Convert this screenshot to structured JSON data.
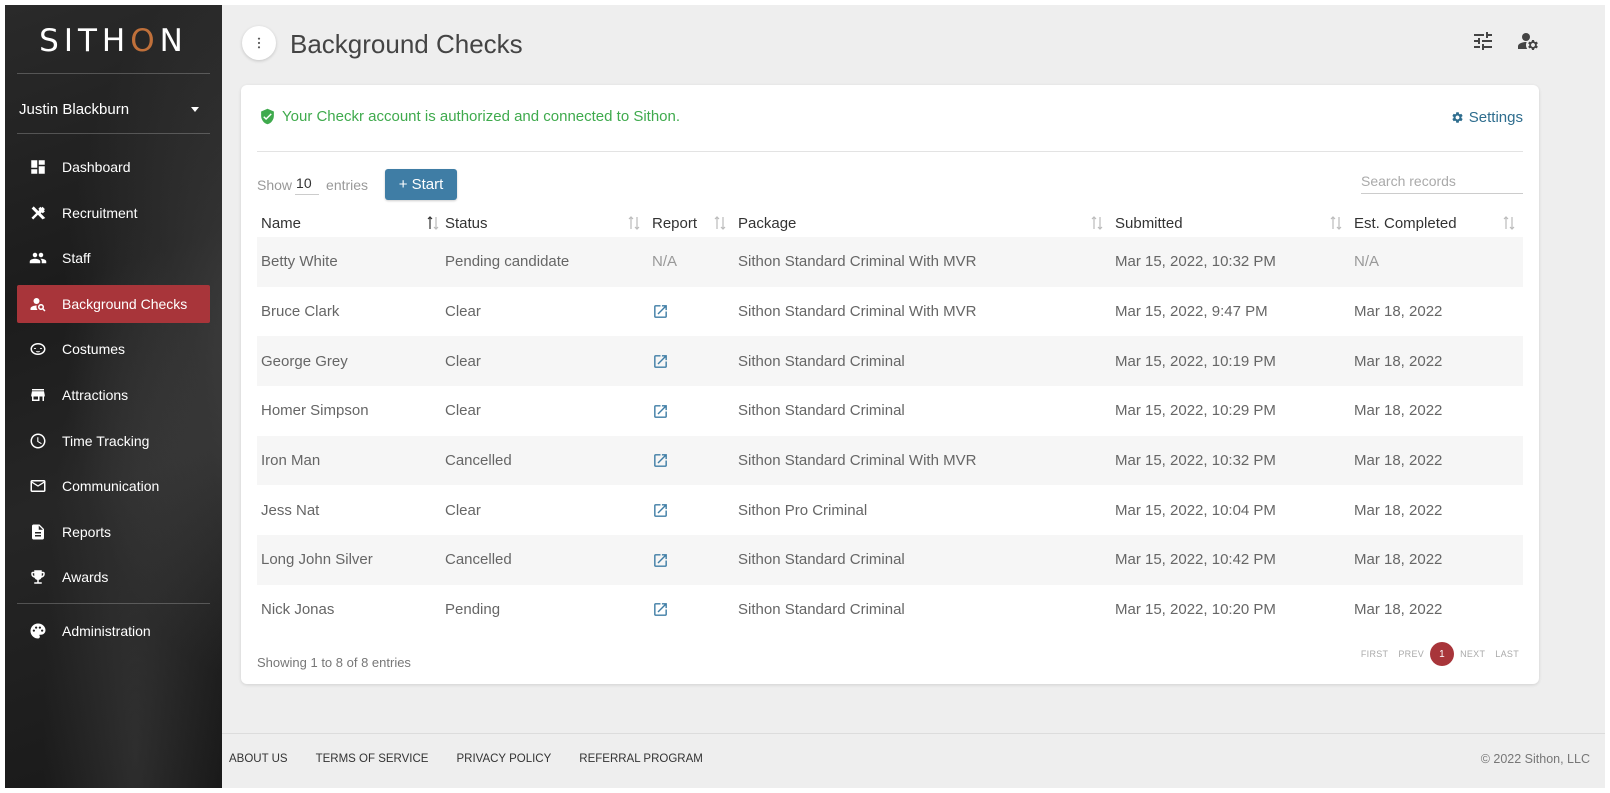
{
  "app": {
    "logo": {
      "pre": "SITH",
      "o": "O",
      "post": "N"
    },
    "user_name": "Justin Blackburn"
  },
  "sidebar": {
    "items": [
      {
        "label": "Dashboard",
        "icon": "dashboard-icon"
      },
      {
        "label": "Recruitment",
        "icon": "tools-icon"
      },
      {
        "label": "Staff",
        "icon": "people-icon"
      },
      {
        "label": "Background Checks",
        "icon": "person-search-icon",
        "active": true
      },
      {
        "label": "Costumes",
        "icon": "mask-icon"
      },
      {
        "label": "Attractions",
        "icon": "storefront-icon"
      },
      {
        "label": "Time Tracking",
        "icon": "clock-icon"
      },
      {
        "label": "Communication",
        "icon": "mail-icon"
      },
      {
        "label": "Reports",
        "icon": "document-icon"
      },
      {
        "label": "Awards",
        "icon": "trophy-icon"
      }
    ],
    "admin": {
      "label": "Administration",
      "icon": "palette-icon"
    }
  },
  "header": {
    "title": "Background Checks"
  },
  "card": {
    "auth_message": "Your Checkr account is authorized and connected to Sithon.",
    "settings_label": "Settings",
    "show_label": "Show",
    "entries_count": "10",
    "entries_label": "entries",
    "start_label": "+ Start",
    "search_placeholder": "Search records"
  },
  "table": {
    "columns": [
      "Name",
      "Status",
      "Report",
      "Package",
      "Submitted",
      "Est. Completed"
    ],
    "rows": [
      {
        "name": "Betty White",
        "status": "Pending candidate",
        "report": "N/A",
        "package": "Sithon Standard Criminal With MVR",
        "submitted": "Mar 15, 2022, 10:32 PM",
        "completed": "N/A"
      },
      {
        "name": "Bruce Clark",
        "status": "Clear",
        "report": "link",
        "package": "Sithon Standard Criminal With MVR",
        "submitted": "Mar 15, 2022, 9:47 PM",
        "completed": "Mar 18, 2022"
      },
      {
        "name": "George Grey",
        "status": "Clear",
        "report": "link",
        "package": "Sithon Standard Criminal",
        "submitted": "Mar 15, 2022, 10:19 PM",
        "completed": "Mar 18, 2022"
      },
      {
        "name": "Homer Simpson",
        "status": "Clear",
        "report": "link",
        "package": "Sithon Standard Criminal",
        "submitted": "Mar 15, 2022, 10:29 PM",
        "completed": "Mar 18, 2022"
      },
      {
        "name": "Iron Man",
        "status": "Cancelled",
        "report": "link",
        "package": "Sithon Standard Criminal With MVR",
        "submitted": "Mar 15, 2022, 10:32 PM",
        "completed": "Mar 18, 2022"
      },
      {
        "name": "Jess Nat",
        "status": "Clear",
        "report": "link",
        "package": "Sithon Pro Criminal",
        "submitted": "Mar 15, 2022, 10:04 PM",
        "completed": "Mar 18, 2022"
      },
      {
        "name": "Long John Silver",
        "status": "Cancelled",
        "report": "link",
        "package": "Sithon Standard Criminal",
        "submitted": "Mar 15, 2022, 10:42 PM",
        "completed": "Mar 18, 2022"
      },
      {
        "name": "Nick Jonas",
        "status": "Pending",
        "report": "link",
        "package": "Sithon Standard Criminal",
        "submitted": "Mar 15, 2022, 10:20 PM",
        "completed": "Mar 18, 2022"
      }
    ],
    "showing_text": "Showing 1 to 8 of 8 entries"
  },
  "pagination": {
    "first": "FIRST",
    "prev": "PREV",
    "current": "1",
    "next": "NEXT",
    "last": "LAST"
  },
  "footer": {
    "links": [
      "ABOUT US",
      "TERMS OF SERVICE",
      "PRIVACY POLICY",
      "REFERRAL PROGRAM"
    ],
    "copyright": "© 2022 Sithon, LLC"
  },
  "colors": {
    "active_nav": "#a8353a",
    "primary_button": "#3f7da5",
    "success_text": "#3faa4d",
    "link": "#2e6d8e"
  }
}
